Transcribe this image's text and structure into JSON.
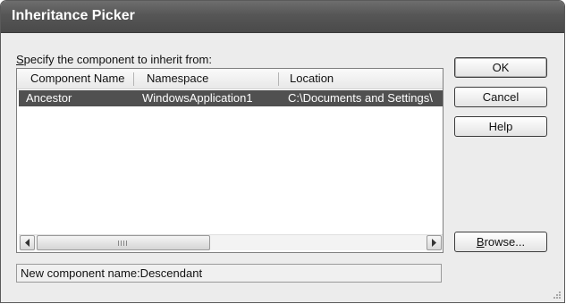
{
  "dialog": {
    "title": "Inheritance Picker",
    "prompt_accel": "S",
    "prompt_rest": "pecify the component to inherit from:"
  },
  "list": {
    "columns": [
      "Component Name",
      "Namespace",
      "Location"
    ],
    "rows": [
      {
        "component_name": "Ancestor",
        "namespace": "WindowsApplication1",
        "location": "C:\\Documents and Settings\\"
      }
    ],
    "selected_row": 0
  },
  "buttons": {
    "ok": "OK",
    "cancel": "Cancel",
    "help": "Help",
    "browse_accel": "B",
    "browse_rest": "rowse..."
  },
  "status": {
    "text": "New component name:Descendant"
  }
}
